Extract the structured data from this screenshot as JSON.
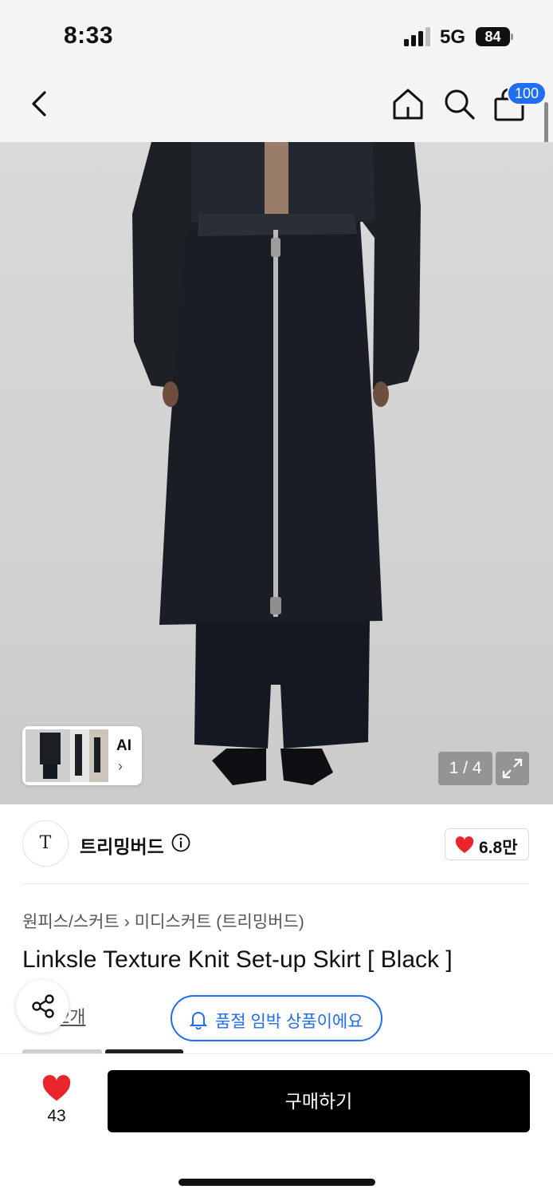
{
  "status_bar": {
    "time": "8:33",
    "network": "5G",
    "battery": "84"
  },
  "nav": {
    "cart_count": "100"
  },
  "gallery": {
    "counter": "1 / 4",
    "ai_label": "AI",
    "ai_chevron": "›"
  },
  "brand": {
    "logo_text": "T",
    "name": "트리밍버드",
    "likes": "6.8만"
  },
  "breadcrumb": {
    "category": "원피스/스커트",
    "separator": "›",
    "subcategory": "미디스커트 (트리밍버드)"
  },
  "product": {
    "title": "Linksle Texture Knit Set-up Skirt [ Black ]",
    "review_label": "2개"
  },
  "notice": {
    "soldout_text": "품절 임박 상품이에요"
  },
  "bottom": {
    "wish_count": "43",
    "buy_label": "구매하기"
  },
  "colors": {
    "accent": "#1f6cf5",
    "heart": "#e8262b",
    "button": "#000000"
  },
  "icons": [
    "back-icon",
    "home-icon",
    "search-icon",
    "bag-icon",
    "expand-icon",
    "info-icon",
    "heart-icon",
    "share-icon",
    "bell-icon"
  ]
}
